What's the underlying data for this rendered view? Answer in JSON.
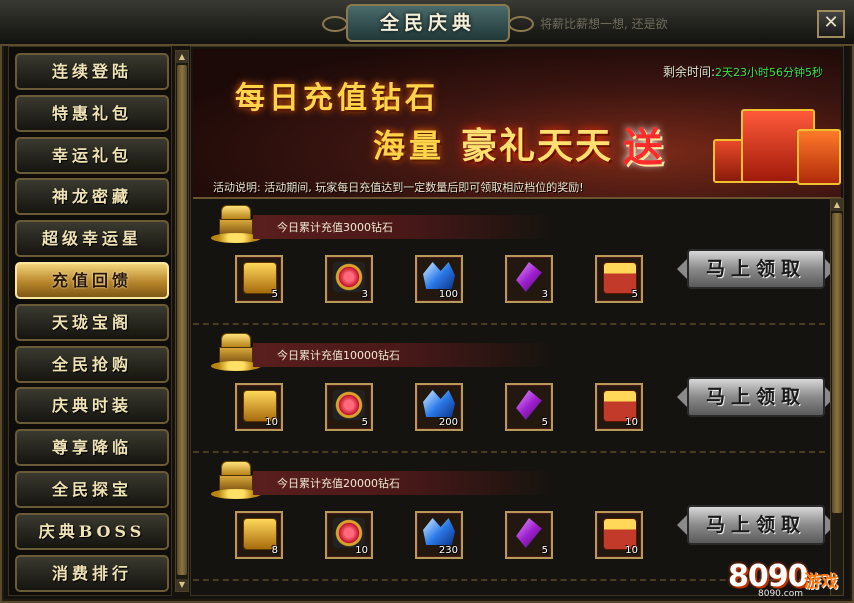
{
  "window": {
    "title": "全民庆典",
    "background_ghost_text": "将薪比薪想一想, 还是欲",
    "close_label": "✕"
  },
  "sidebar": {
    "items": [
      {
        "label": "连续登陆",
        "active": false
      },
      {
        "label": "特惠礼包",
        "active": false
      },
      {
        "label": "幸运礼包",
        "active": false
      },
      {
        "label": "神龙密藏",
        "active": false
      },
      {
        "label": "超级幸运星",
        "active": false
      },
      {
        "label": "充值回馈",
        "active": true
      },
      {
        "label": "天珑宝阁",
        "active": false
      },
      {
        "label": "全民抢购",
        "active": false
      },
      {
        "label": "庆典时装",
        "active": false
      },
      {
        "label": "尊享降临",
        "active": false
      },
      {
        "label": "全民探宝",
        "active": false
      },
      {
        "label": "庆典BOSS",
        "active": false
      },
      {
        "label": "消费排行",
        "active": false
      }
    ]
  },
  "banner": {
    "line1": "每日充值钻石",
    "line2a": "海量",
    "line2b": "豪礼天天",
    "line2c": "送",
    "remaining_label": "剩余时间:",
    "remaining_value": "2天23小时56分钟5秒",
    "description": "活动说明:  活动期间, 玩家每日充值达到一定数量后即可领取相应档位的奖励!"
  },
  "tiers": [
    {
      "title": "今日累计充值3000钻石",
      "claim_label": "马上领取",
      "rewards": [
        {
          "icon": "treasure-chest-icon",
          "count": "5"
        },
        {
          "icon": "ruby-amulet-icon",
          "count": "3"
        },
        {
          "icon": "blue-crystal-icon",
          "count": "100"
        },
        {
          "icon": "purple-gem-icon",
          "count": "3"
        },
        {
          "icon": "gold-box-icon",
          "count": "5"
        }
      ]
    },
    {
      "title": "今日累计充值10000钻石",
      "claim_label": "马上领取",
      "rewards": [
        {
          "icon": "treasure-chest-icon",
          "count": "10"
        },
        {
          "icon": "ruby-amulet-icon",
          "count": "5"
        },
        {
          "icon": "blue-crystal-icon",
          "count": "200"
        },
        {
          "icon": "purple-gem-icon",
          "count": "5"
        },
        {
          "icon": "gold-box-icon",
          "count": "10"
        }
      ]
    },
    {
      "title": "今日累计充值20000钻石",
      "claim_label": "马上领取",
      "rewards": [
        {
          "icon": "treasure-chest-icon",
          "count": "8"
        },
        {
          "icon": "ruby-amulet-icon",
          "count": "10"
        },
        {
          "icon": "blue-crystal-icon",
          "count": "230"
        },
        {
          "icon": "purple-gem-icon",
          "count": "5"
        },
        {
          "icon": "gold-box-icon",
          "count": "10"
        }
      ]
    }
  ],
  "watermark": {
    "number": "8090",
    "text": "游戏",
    "url": "8090.com"
  }
}
